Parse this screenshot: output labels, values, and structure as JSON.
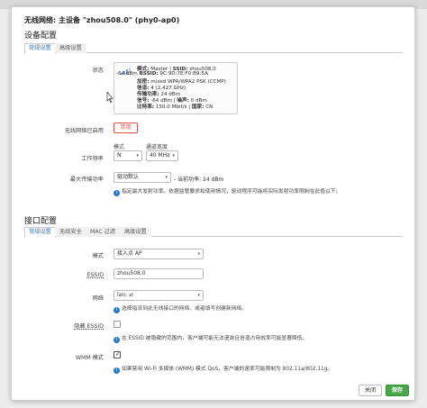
{
  "modal": {
    "title": "无线网络: 主设备 \"zhou508.0\" (phy0-ap0)",
    "device_section_title": "设备配置",
    "device_tabs": [
      "常规设置",
      "高级设置"
    ],
    "status_label": "状态",
    "status": {
      "mode_label": "模式:",
      "mode": "Master",
      "ssid_label": "SSID:",
      "ssid": "zhou508.0",
      "dbm": "-64 dBm",
      "bssid_label": "BSSID:",
      "bssid": "9C:9D:7E:F0:B9:5A",
      "encryption_label": "加密:",
      "encryption": "mixed WPA/WPA2 PSK (CCMP)",
      "channel_label": "信道:",
      "channel": "4 (2.427 GHz)",
      "tx_power_label": "传输功率:",
      "tx_power": "24 dBm",
      "signal_label": "信号:",
      "signal": "-64 dBm",
      "noise_label": "噪声:",
      "noise": "0 dBm",
      "bitrate_label": "比特率:",
      "bitrate": "150.0 Mbit/s",
      "country_label": "国家:",
      "country": "CN"
    },
    "wireless_enabled_label": "无线网络已启用",
    "disable_button": "禁用",
    "operating_freq_label": "工作频率",
    "mode_col_label": "模式",
    "width_col_label": "通道宽度",
    "mode_value": "N",
    "width_value": "40 MHz",
    "max_tx_label": "最大传输功率",
    "max_tx_value": "驱动默认",
    "current_power": "- 当前功率: 24 dBm",
    "max_tx_hint": "指定最大发射功率。依据监管要求和使用情况，驱动程序可能将实际发射功率限制在此值以下。",
    "interface_section_title": "接口配置",
    "interface_tabs": [
      "常规设置",
      "无线安全",
      "MAC 过滤",
      "高级设置"
    ],
    "if_mode_label": "模式",
    "if_mode_value": "接入点 AP",
    "essid_label": "ESSID",
    "essid_value": "zhou508.0",
    "network_label": "网络",
    "network_value": "lan:",
    "network_hint": "选择指派到此无线接口的网络，或者填写创建新网络。",
    "hide_essid_label": "隐藏 ESSID",
    "hide_essid_hint": "在 ESSID 被隐藏的范围内，客户端可能无法漫游且信道占用效率可能显著降低。",
    "wmm_label": "WMM 模式",
    "wmm_hint": "如果禁用 Wi-Fi 多媒体 (WMM) 模式 QoS，客户端的速率可能限制为 802.11a/802.11g。",
    "close_button": "关闭",
    "save_button": "保存"
  },
  "colors": {
    "accent": "#2e77c8",
    "danger": "#d9534f",
    "save": "#4aa84a"
  }
}
